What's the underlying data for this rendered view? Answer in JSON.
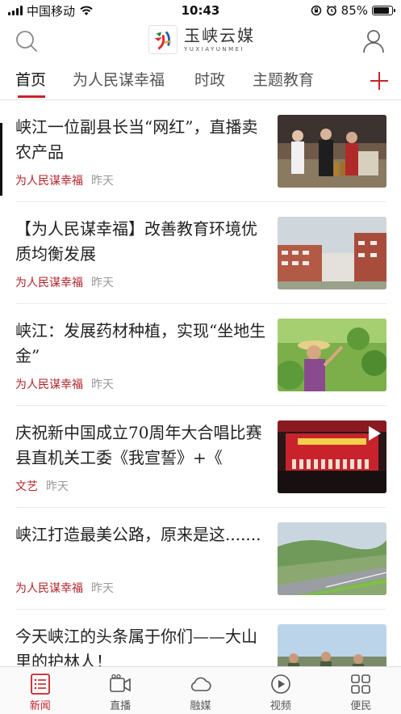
{
  "status_bar": {
    "carrier": "中国移动",
    "time": "10:43",
    "battery": "85%",
    "battery_level": 0.85
  },
  "header": {
    "logo_cn": "玉峡云媒",
    "logo_en": "YUXIAYUNMEI",
    "search_icon": "search-icon",
    "user_icon": "user-icon"
  },
  "tabs": [
    {
      "label": "首页",
      "active": true
    },
    {
      "label": "为人民谋幸福",
      "active": false
    },
    {
      "label": "时政",
      "active": false
    },
    {
      "label": "主题教育",
      "active": false
    }
  ],
  "news": [
    {
      "title": "峡江一位副县长当“网红”，直播卖农产品",
      "category": "为人民谋幸福",
      "time": "昨天",
      "thumb": "people-at-product-stall"
    },
    {
      "title": "【为人民谋幸福】改善教育环境优质均衡发展",
      "category": "为人民谋幸福",
      "time": "昨天",
      "thumb": "school-buildings"
    },
    {
      "title": "峡江：发展药材种植，实现“坐地生金”",
      "category": "为人民谋幸福",
      "time": "昨天",
      "thumb": "farmer-in-field"
    },
    {
      "title": "庆祝新中国成立70周年大合唱比赛 县直机关工委《我宣誓》+《",
      "category": "文艺",
      "time": "昨天",
      "thumb": "choir-stage-video"
    },
    {
      "title": "峡江打造最美公路，原来是这.......",
      "category": "为人民谋幸福",
      "time": "昨天",
      "thumb": "highway-scenery"
    },
    {
      "title": "今天峡江的头条属于你们——大山里的护林人！",
      "category": "",
      "time": "",
      "thumb": "forest-rangers"
    }
  ],
  "bottom_nav": [
    {
      "label": "新闻",
      "icon": "news-list-icon",
      "active": true
    },
    {
      "label": "直播",
      "icon": "video-camera-icon",
      "active": false
    },
    {
      "label": "融媒",
      "icon": "cloud-icon",
      "active": false
    },
    {
      "label": "视频",
      "icon": "play-circle-icon",
      "active": false
    },
    {
      "label": "便民",
      "icon": "grid-icon",
      "active": false
    }
  ],
  "colors": {
    "accent": "#c8232c",
    "category": "#b3242b",
    "meta": "#999999"
  }
}
